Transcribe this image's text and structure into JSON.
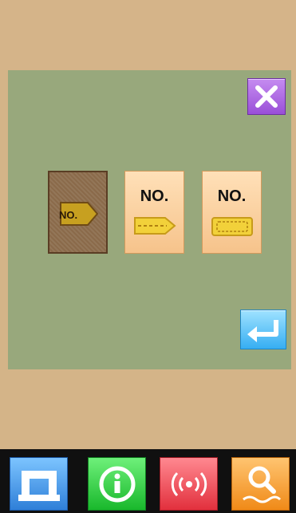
{
  "pattern_buttons": [
    {
      "label": "NO.",
      "selected": true
    },
    {
      "label": "NO.",
      "selected": false
    },
    {
      "label": "NO.",
      "selected": false
    }
  ],
  "icons": {
    "close": "close-icon",
    "enter": "enter-arrow-icon",
    "sewing": "sewing-machine-icon",
    "info": "info-icon",
    "communication": "wireless-signal-icon",
    "search": "search-icon"
  },
  "colors": {
    "background": "#d4b488",
    "panel": "#98a87c",
    "close_button": "#a55ce0",
    "enter_button": "#4fbaf2",
    "selected_pattern": "#8a6a4a",
    "pattern_button": "#f6c38b",
    "taskbar": "#101010"
  }
}
